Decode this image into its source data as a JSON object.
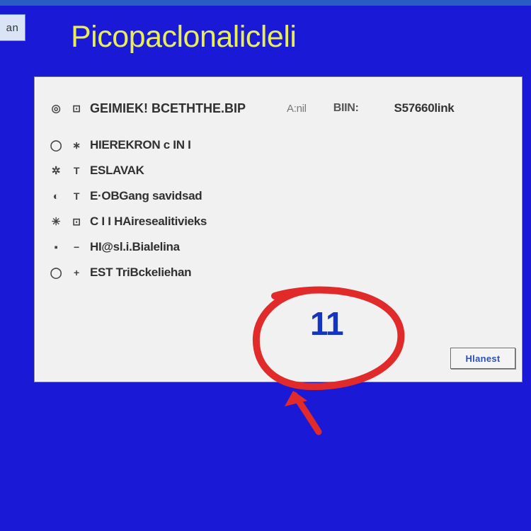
{
  "tab_fragment": "an",
  "title": "Picopaclonalicleli",
  "list": {
    "row0": {
      "icon": "◎",
      "glyph": "⊡",
      "label": "GEIMIEK! BCETHTHE.BIP",
      "meta1": "A:nil",
      "meta2": "BIIN:",
      "meta3": "S57660link"
    },
    "row1": {
      "icon": "◯",
      "glyph": "∗",
      "label": "HIEREKRON c IN I"
    },
    "row2": {
      "icon": "✲",
      "glyph": "T",
      "label": "ESLAVAK"
    },
    "row3": {
      "icon": "◐",
      "glyph": "T",
      "label": "E·OBGang savidsad"
    },
    "row4": {
      "icon": "✳",
      "glyph": "⊡",
      "label": "C I I HAiresealitivieks"
    },
    "row5": {
      "icon": "▪",
      "glyph": "−",
      "label": "HI@sl.i.Bialelina"
    },
    "row6": {
      "icon": "◯",
      "glyph": "+",
      "label": "EST TriBckeliehan"
    }
  },
  "callout": "11",
  "button_label": "Hlanest"
}
